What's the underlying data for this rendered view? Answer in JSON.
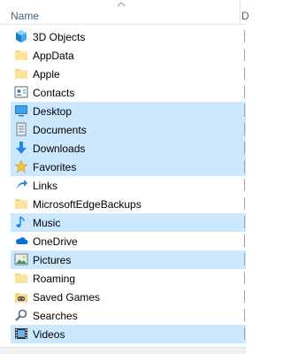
{
  "header": {
    "name_label": "Name",
    "next_label": "D"
  },
  "colors": {
    "selected_bg": "#cce8ff",
    "folder_yellow": "#f8d775",
    "blue_icon": "#1e88e5"
  },
  "items": [
    {
      "label": "3D Objects",
      "icon": "3d-objects-icon",
      "selected": false
    },
    {
      "label": "AppData",
      "icon": "folder-icon",
      "selected": false
    },
    {
      "label": "Apple",
      "icon": "folder-icon",
      "selected": false
    },
    {
      "label": "Contacts",
      "icon": "contacts-icon",
      "selected": false
    },
    {
      "label": "Desktop",
      "icon": "desktop-icon",
      "selected": true
    },
    {
      "label": "Documents",
      "icon": "documents-icon",
      "selected": true
    },
    {
      "label": "Downloads",
      "icon": "downloads-icon",
      "selected": true
    },
    {
      "label": "Favorites",
      "icon": "favorites-icon",
      "selected": true
    },
    {
      "label": "Links",
      "icon": "links-icon",
      "selected": false
    },
    {
      "label": "MicrosoftEdgeBackups",
      "icon": "folder-icon",
      "selected": false
    },
    {
      "label": "Music",
      "icon": "music-icon",
      "selected": true
    },
    {
      "label": "OneDrive",
      "icon": "onedrive-icon",
      "selected": false
    },
    {
      "label": "Pictures",
      "icon": "pictures-icon",
      "selected": true
    },
    {
      "label": "Roaming",
      "icon": "folder-icon",
      "selected": false
    },
    {
      "label": "Saved Games",
      "icon": "saved-games-icon",
      "selected": false
    },
    {
      "label": "Searches",
      "icon": "searches-icon",
      "selected": false
    },
    {
      "label": "Videos",
      "icon": "videos-icon",
      "selected": true
    }
  ]
}
